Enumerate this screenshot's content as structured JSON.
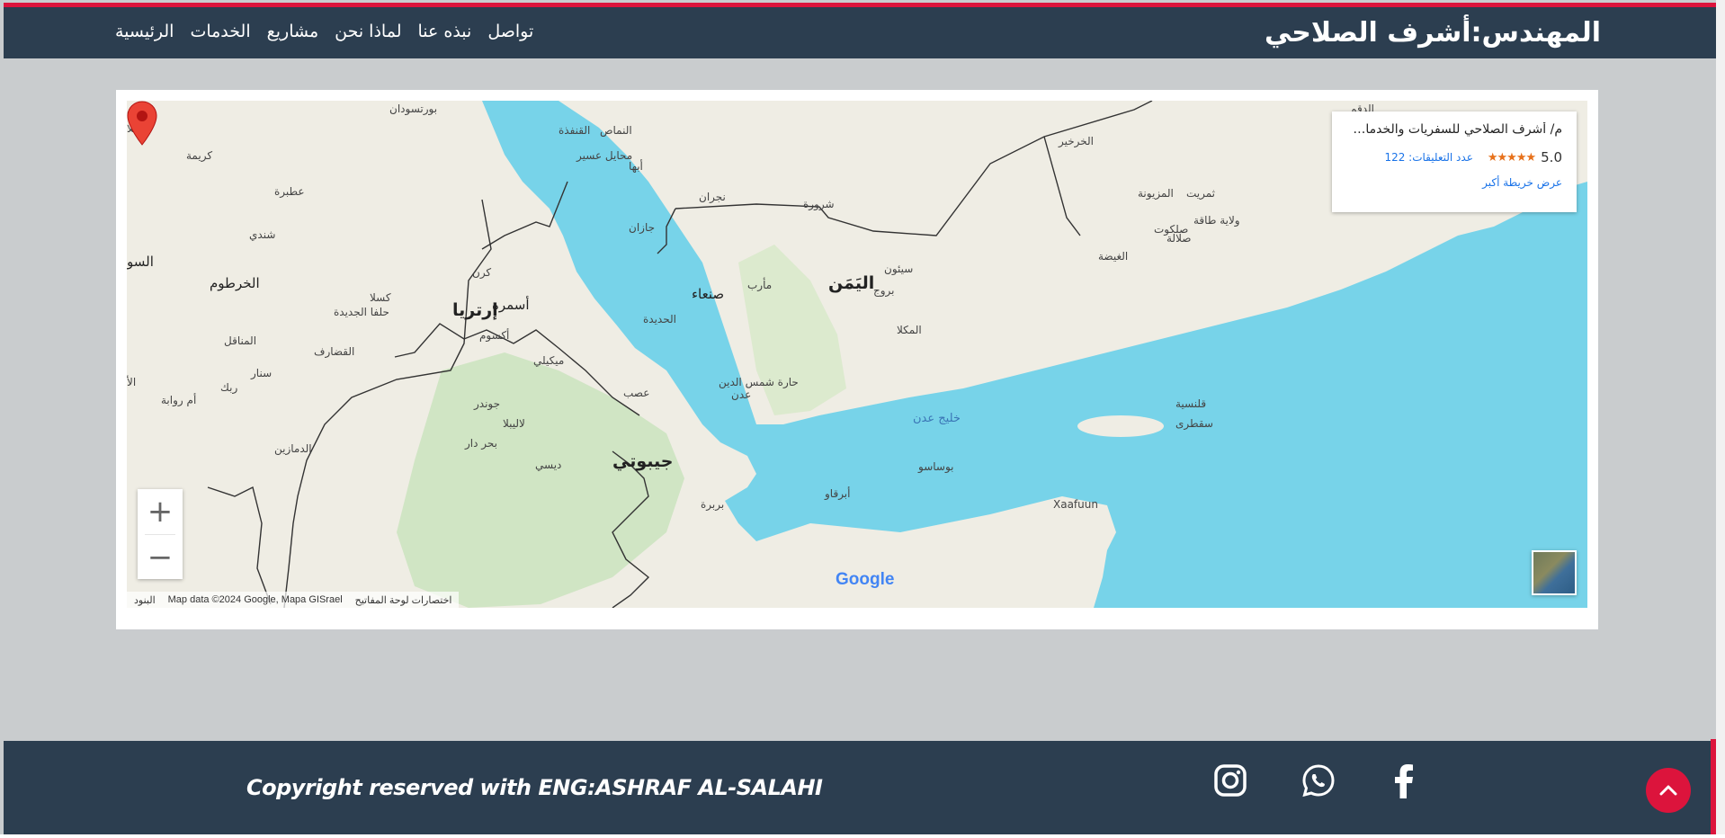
{
  "colors": {
    "navbar_bg": "#2c3e50",
    "accent": "#dc143c",
    "page_bg": "#c9ccce",
    "water": "#77d3e9",
    "land": "#f1efe6"
  },
  "header": {
    "brand": "المهندس:أشرف الصلاحي",
    "nav": [
      "الرئيسية",
      "الخدمات",
      "مشاريع",
      "لماذا نحن",
      "نبذه عنا",
      "تواصل"
    ]
  },
  "map": {
    "place_card": {
      "name": "م/ أشرف الصلاحي للسفريات والخدمات ا...",
      "rating": "5.0",
      "stars": "★★★★★",
      "reviews": "عدد التعليقات: 122",
      "larger_map": "عرض خريطة أكبر"
    },
    "zoom_in": "+",
    "zoom_out": "−",
    "labels": [
      {
        "text": "اليَمَن",
        "size": "big"
      },
      {
        "text": "إرتريا",
        "size": "big"
      },
      {
        "text": "جيبوتي",
        "size": "big"
      },
      {
        "text": "صنعاء",
        "size": "mid"
      },
      {
        "text": "أسمرة",
        "size": "mid"
      },
      {
        "text": "الخرطوم",
        "size": "mid"
      },
      {
        "text": "السو",
        "size": "mid"
      },
      {
        "text": "عدن",
        "size": "small"
      },
      {
        "text": "المكلا",
        "size": "small"
      },
      {
        "text": "الحديدة",
        "size": "small"
      },
      {
        "text": "مأرب",
        "size": "small"
      },
      {
        "text": "سيئون",
        "size": "small"
      },
      {
        "text": "بروج",
        "size": "small"
      },
      {
        "text": "نجران",
        "size": "small"
      },
      {
        "text": "شرورة",
        "size": "small"
      },
      {
        "text": "جازان",
        "size": "small"
      },
      {
        "text": "أبها",
        "size": "small"
      },
      {
        "text": "محايل عسير",
        "size": "small"
      },
      {
        "text": "النماص",
        "size": "small"
      },
      {
        "text": "القنفذة",
        "size": "small"
      },
      {
        "text": "بورتسودان",
        "size": "small"
      },
      {
        "text": "عطبرة",
        "size": "small"
      },
      {
        "text": "شندي",
        "size": "small"
      },
      {
        "text": "كريمة",
        "size": "small"
      },
      {
        "text": "دنقلا",
        "size": "small"
      },
      {
        "text": "كرم",
        "size": "small"
      },
      {
        "text": "كسلا",
        "size": "small"
      },
      {
        "text": "حلفا الجديدة",
        "size": "small"
      },
      {
        "text": "المناقل",
        "size": "small"
      },
      {
        "text": "القضارف",
        "size": "small"
      },
      {
        "text": "سنار",
        "size": "small"
      },
      {
        "text": "ربك",
        "size": "small"
      },
      {
        "text": "أم روابة",
        "size": "small"
      },
      {
        "text": "الدمازين",
        "size": "small"
      },
      {
        "text": "كرن",
        "size": "small"
      },
      {
        "text": "أكسوم",
        "size": "small"
      },
      {
        "text": "ميكيلي",
        "size": "small"
      },
      {
        "text": "عصب",
        "size": "small"
      },
      {
        "text": "جوندر",
        "size": "small"
      },
      {
        "text": "لاليبلا",
        "size": "small"
      },
      {
        "text": "بحر دار",
        "size": "small"
      },
      {
        "text": "ديسي",
        "size": "small"
      },
      {
        "text": "خليج عدن",
        "size": "water"
      },
      {
        "text": "قلنسية",
        "size": "small"
      },
      {
        "text": "سقطرى",
        "size": "small"
      },
      {
        "text": "بوساسو",
        "size": "small"
      },
      {
        "text": "أبرقاو",
        "size": "small"
      },
      {
        "text": "بربرة",
        "size": "small"
      },
      {
        "text": "Xaafuun",
        "size": "small"
      },
      {
        "text": "الغيضة",
        "size": "small"
      },
      {
        "text": "صلالة",
        "size": "small"
      },
      {
        "text": "صلكوت",
        "size": "small"
      },
      {
        "text": "ولاية طاقة",
        "size": "small"
      },
      {
        "text": "ثمريت",
        "size": "small"
      },
      {
        "text": "المزيونة",
        "size": "small"
      },
      {
        "text": "الخرخير",
        "size": "small"
      },
      {
        "text": "الدقم",
        "size": "small"
      },
      {
        "text": "حارة شمس الدين",
        "size": "small"
      },
      {
        "text": "الأ",
        "size": "small"
      }
    ],
    "google": "Google",
    "attribution": {
      "shortcuts": "اختصارات لوحة المفاتيح",
      "data": "Map data ©2024 Google, Mapa GISrael",
      "terms": "البنود"
    }
  },
  "footer": {
    "copyright": "Copyright reserved with ENG:ASHRAF AL-SALAHI",
    "social": [
      "instagram-icon",
      "whatsapp-icon",
      "facebook-icon"
    ],
    "scroll_top": "chevron-up-icon"
  }
}
